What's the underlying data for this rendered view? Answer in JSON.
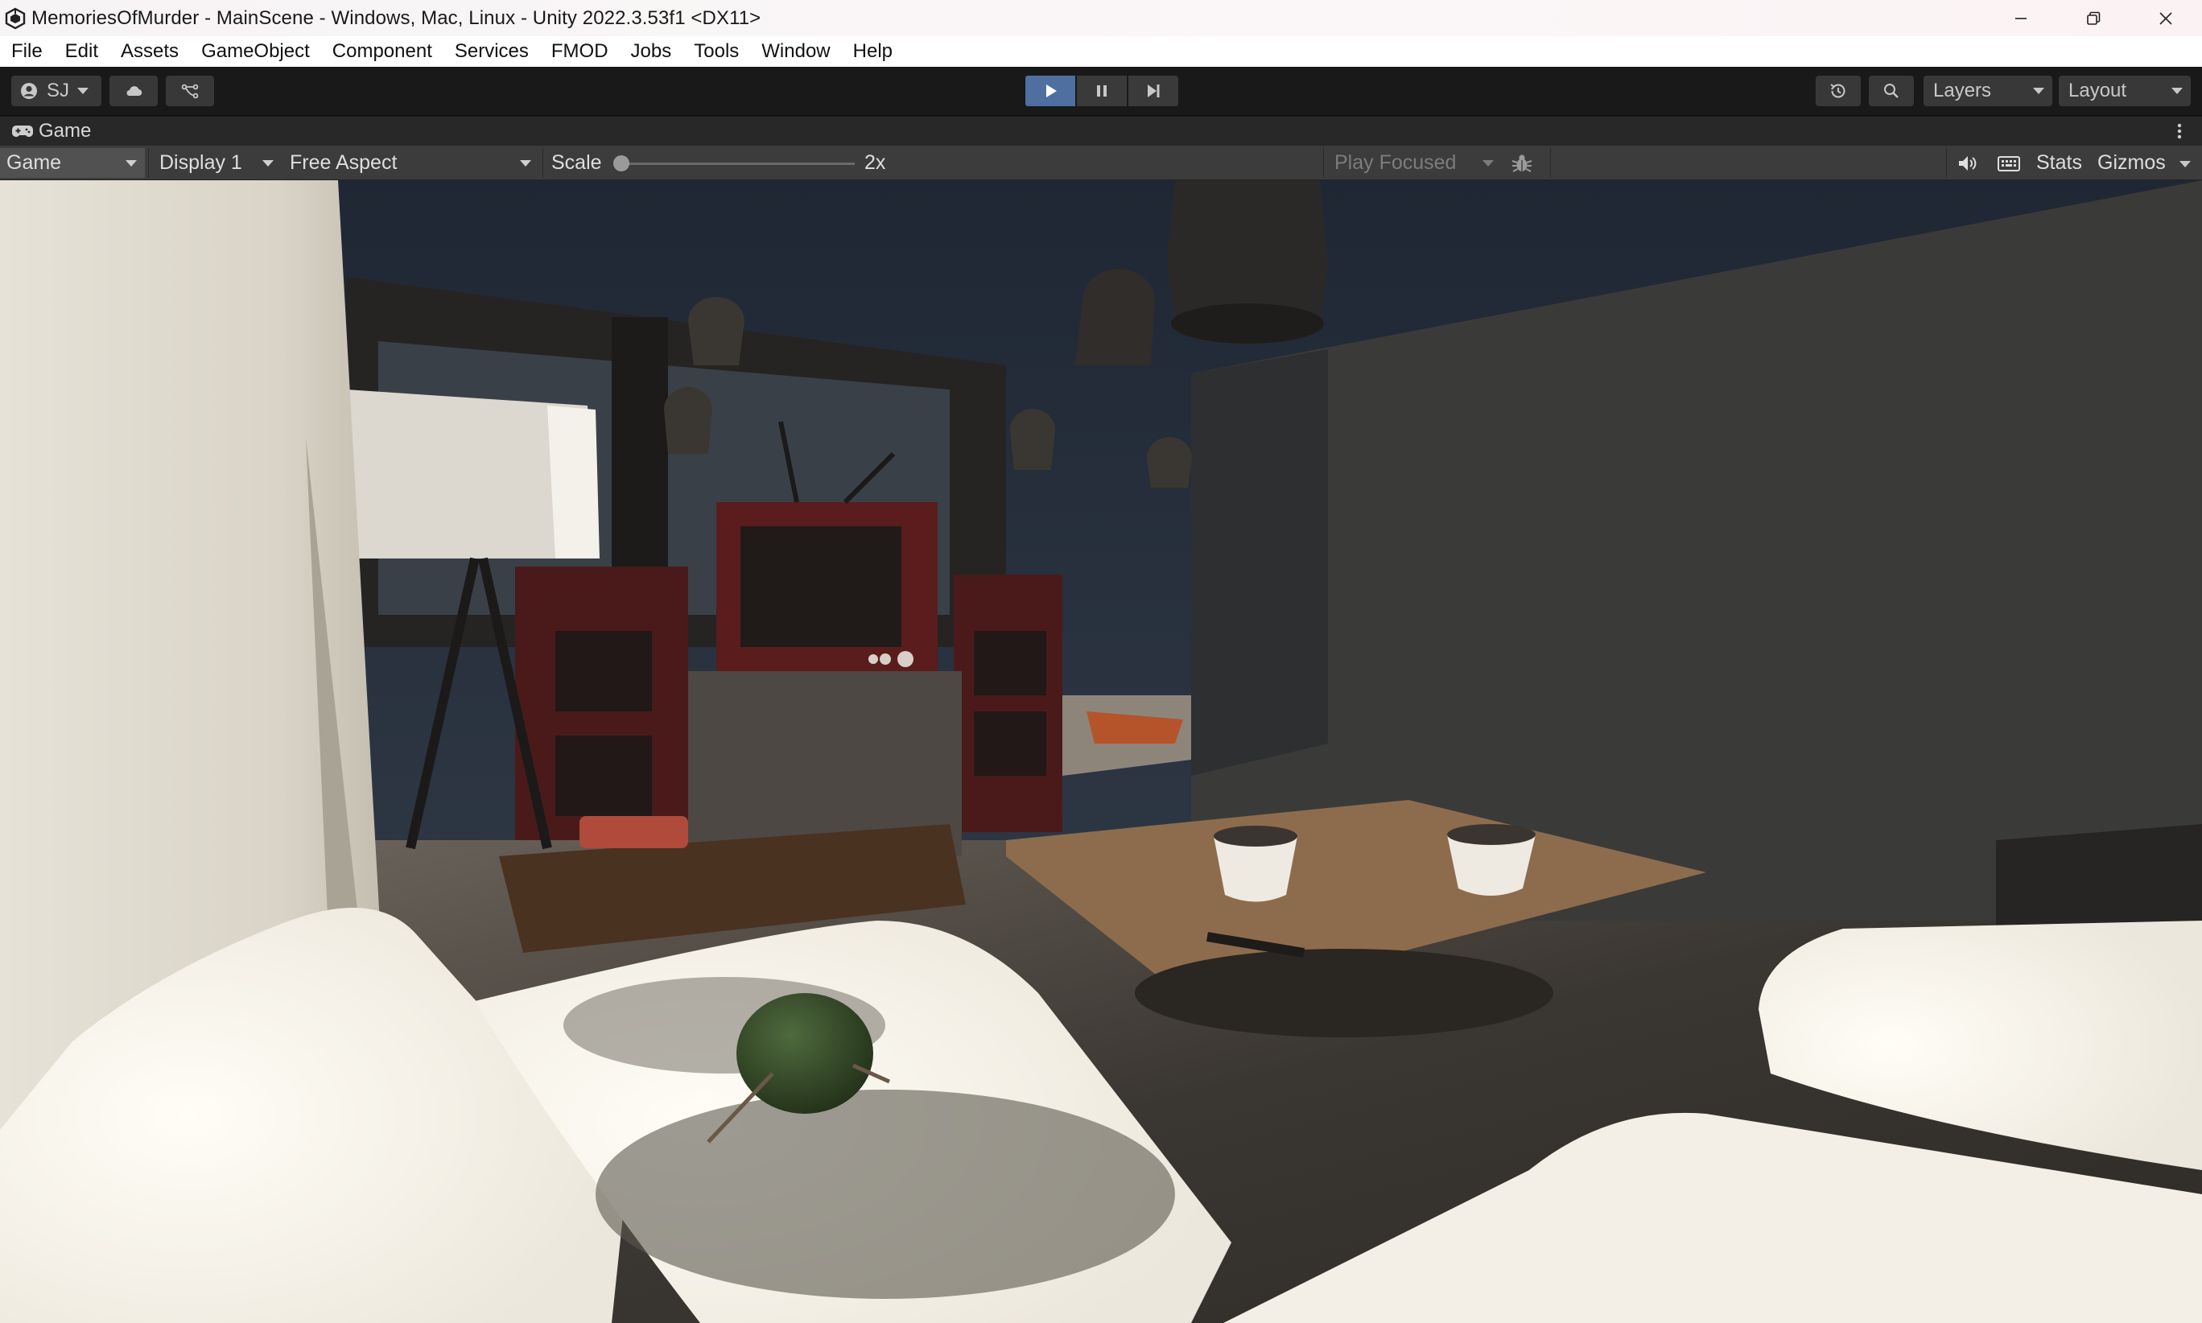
{
  "window": {
    "title": "MemoriesOfMurder - MainScene - Windows, Mac, Linux - Unity 2022.3.53f1 <DX11>",
    "controls": [
      "minimize-icon",
      "restore-icon",
      "close-icon"
    ]
  },
  "menubar": {
    "items": [
      "File",
      "Edit",
      "Assets",
      "GameObject",
      "Component",
      "Services",
      "FMOD",
      "Jobs",
      "Tools",
      "Window",
      "Help"
    ]
  },
  "toolbar": {
    "account_label": "SJ",
    "play_state": "playing",
    "layers_label": "Layers",
    "layout_label": "Layout",
    "colors": {
      "play_active": "#4e6f9f",
      "button": "#383838"
    }
  },
  "game_window": {
    "tab_label": "Game",
    "mode": "Game",
    "display": "Display 1",
    "aspect": "Free Aspect",
    "scale_label": "Scale",
    "scale_value": "2x",
    "play_focused": "Play Focused",
    "stats_label": "Stats",
    "gizmos_label": "Gizmos"
  }
}
